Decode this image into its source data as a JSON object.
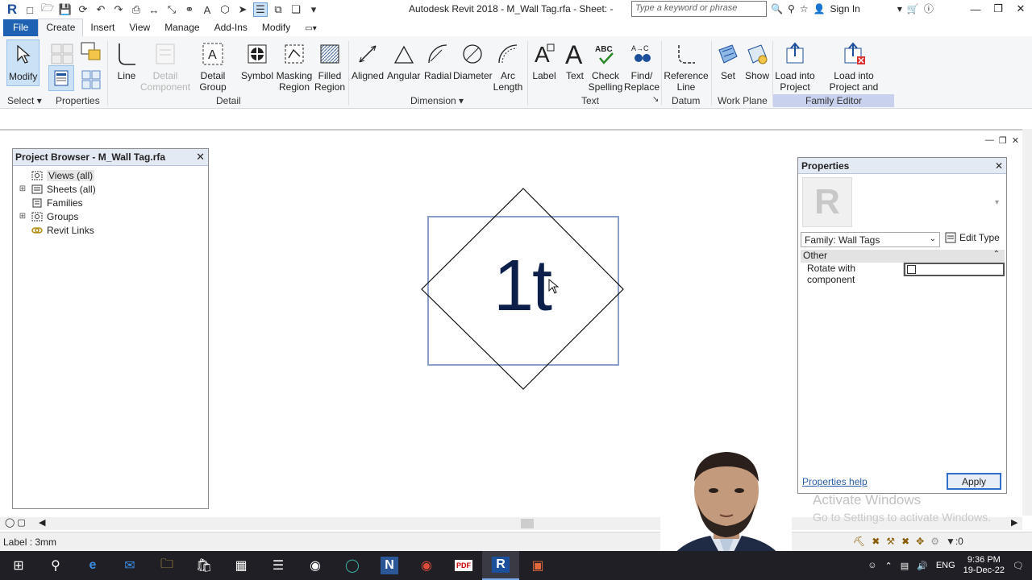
{
  "title_bar": {
    "app_title": "Autodesk Revit 2018 -    M_Wall Tag.rfa - Sheet: -",
    "search_placeholder": "Type a keyword or phrase",
    "sign_in": "Sign In"
  },
  "ribbon_tabs": [
    "File",
    "Create",
    "Insert",
    "View",
    "Manage",
    "Add-Ins",
    "Modify"
  ],
  "ribbon_buttons": {
    "modify": "Modify",
    "line": "Line",
    "detail_component": "Detail Component",
    "detail_group": "Detail Group",
    "symbol": "Symbol",
    "masking_region": "Masking Region",
    "filled_region": "Filled Region",
    "aligned": "Aligned",
    "angular": "Angular",
    "radial": "Radial",
    "diameter": "Diameter",
    "arc_length": "Arc Length",
    "label": "Label",
    "text": "Text",
    "check_spelling": "Check Spelling",
    "find_replace": "Find/ Replace",
    "reference_line": "Reference Line",
    "set": "Set",
    "show": "Show",
    "load_into_project": "Load into Project",
    "load_into_project_and_close": "Load into Project and Close"
  },
  "ribbon_panels": {
    "select": "Select",
    "properties": "Properties",
    "detail": "Detail",
    "dimension": "Dimension",
    "text": "Text",
    "datum": "Datum",
    "work_plane": "Work Plane",
    "family_editor": "Family Editor"
  },
  "project_browser": {
    "title": "Project Browser - M_Wall Tag.rfa",
    "items": [
      {
        "label": "Views (all)"
      },
      {
        "label": "Sheets (all)"
      },
      {
        "label": "Families"
      },
      {
        "label": "Groups"
      },
      {
        "label": "Revit Links"
      }
    ]
  },
  "canvas": {
    "tag_text": "1t"
  },
  "properties_palette": {
    "title": "Properties",
    "type_selector": "Family: Wall Tags",
    "edit_type": "Edit Type",
    "group": "Other",
    "param_name": "Rotate with component",
    "param_checked": false,
    "help_link": "Properties help",
    "apply": "Apply"
  },
  "watermark": {
    "line1": "Activate Windows",
    "line2": "Go to Settings to activate Windows."
  },
  "status_bar": {
    "text": "Label : 3mm",
    "filter_count": ":0"
  },
  "taskbar": {
    "language": "ENG",
    "time": "9:36 PM",
    "date": "19-Dec-22"
  }
}
